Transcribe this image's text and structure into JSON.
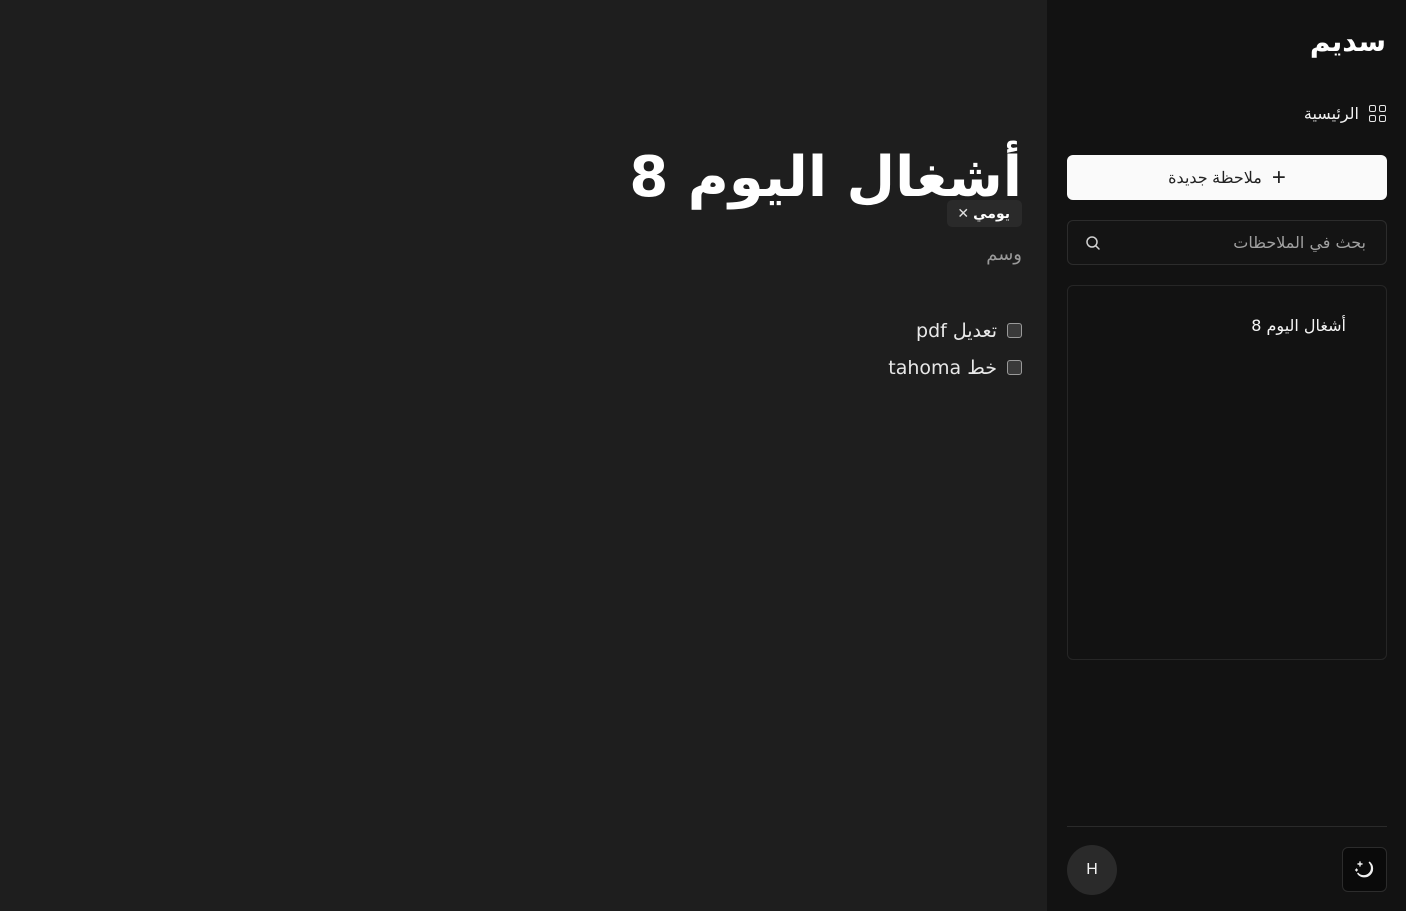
{
  "sidebar": {
    "brand": "سديم",
    "nav": {
      "home_label": "الرئيسية",
      "home_icon": "grid-icon"
    },
    "new_note": {
      "label": "ملاحظة جديدة",
      "icon": "plus-icon"
    },
    "search": {
      "placeholder": "بحث في الملاحظات",
      "icon": "search-icon",
      "value": ""
    },
    "notes": [
      {
        "title": "أشغال اليوم 8"
      }
    ],
    "footer": {
      "avatar_initial": "H",
      "theme_toggle_icon": "moon-stars-icon"
    }
  },
  "note": {
    "title": "أشغال اليوم 8",
    "tags": [
      {
        "label": "يومي",
        "remove_icon": "close-icon"
      }
    ],
    "tag_input_placeholder": "وسم",
    "checklist": [
      {
        "label": "تعديل pdf",
        "checked": false
      },
      {
        "label": "خط tahoma",
        "checked": false
      }
    ]
  },
  "colors": {
    "background": "#1e1e1e",
    "sidebar": "#121212",
    "primary_button": "#fafafa",
    "text": "#ffffff"
  }
}
